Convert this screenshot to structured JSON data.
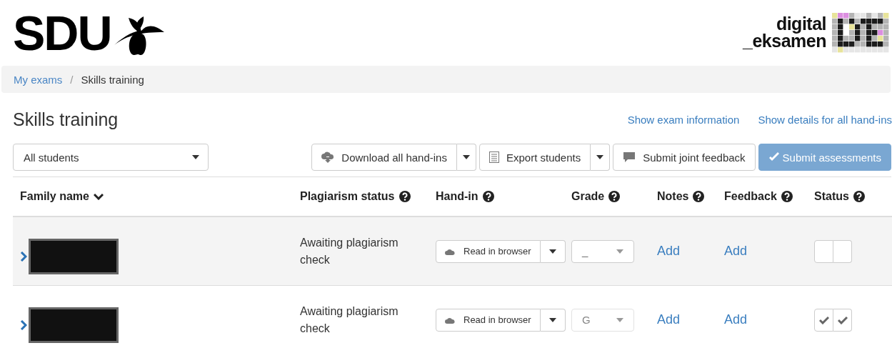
{
  "header": {
    "logo_text": "SDU",
    "brand_line_1": "digital",
    "brand_line_2": "_eksamen"
  },
  "breadcrumb": [
    {
      "label": "My exams",
      "kind": "link"
    },
    {
      "separator": "/",
      "label": "Skills training",
      "kind": "current"
    }
  ],
  "page_title": "Skills training",
  "header_links": [
    "Show exam information",
    "Show details for all hand-ins"
  ],
  "filter": {
    "value": "All students"
  },
  "toolbar": [
    {
      "label": "Download all hand-ins",
      "kind": "split"
    },
    {
      "label": "Export students",
      "kind": "split"
    },
    {
      "label": "Submit joint feedback",
      "kind": "plain"
    },
    {
      "label": "Submit assessments",
      "kind": "primary",
      "disabled": true
    }
  ],
  "table": {
    "columns": [
      {
        "label": "Family name",
        "kind": "sortable"
      },
      {
        "label": "Plagiarism status",
        "kind": "help"
      },
      {
        "label": "Hand-in",
        "kind": "help"
      },
      {
        "label": "Grade",
        "kind": "help"
      },
      {
        "label": "Notes",
        "kind": "help"
      },
      {
        "label": "Feedback",
        "kind": "help"
      },
      {
        "label": "Status",
        "kind": "help"
      }
    ],
    "rows": [
      {
        "plagiarism": "Awaiting plagiarism check",
        "handin": "Read in browser",
        "grade": "_",
        "grade_disabled": false,
        "notes": "Add",
        "feedback": "Add",
        "status": [
          {
            "checked": false
          },
          {
            "checked": false
          }
        ]
      },
      {
        "plagiarism": "Awaiting plagiarism check",
        "handin": "Read in browser",
        "grade": "G",
        "grade_disabled": true,
        "notes": "Add",
        "feedback": "Add",
        "status": [
          {
            "checked": true
          },
          {
            "checked": true
          }
        ]
      }
    ]
  }
}
